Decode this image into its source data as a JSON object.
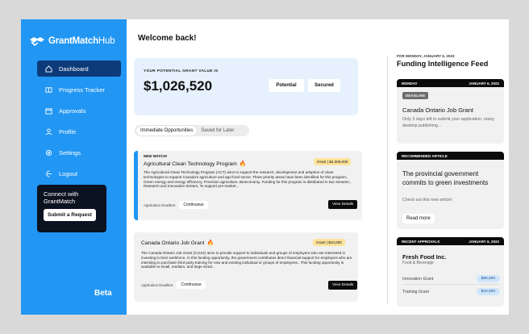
{
  "sidebar": {
    "brand": {
      "bold": "GrantMatch",
      "light": "Hub"
    },
    "items": [
      {
        "label": "Dashboard",
        "icon": "home-icon"
      },
      {
        "label": "Progress Tracker",
        "icon": "book-icon"
      },
      {
        "label": "Approvals",
        "icon": "calendar-icon"
      },
      {
        "label": "Profile",
        "icon": "user-icon"
      },
      {
        "label": "Settings",
        "icon": "gear-icon"
      },
      {
        "label": "Logout",
        "icon": "logout-icon"
      }
    ],
    "connect": {
      "title": "Connect with GrantMatch",
      "button": "Submit a Request"
    },
    "beta": "Beta"
  },
  "main": {
    "welcome": "Welcome back!",
    "value": {
      "label": "YOUR POTENTIAL GRANT VALUE IS",
      "amount": "$1,026,520",
      "potential": "Potential",
      "secured": "Secured"
    },
    "tabs": [
      "Immediate Opportunities",
      "Saved for Later"
    ],
    "grants": [
      {
        "new": "NEW MATCH!",
        "title": "Agricultural Clean Technology Program",
        "badge": "Grant | $2,000,000",
        "desc": "The Agricultural Clean Technology Program (ACT) aims to support the research, development and adoption of clean technologies to support Canada's agriculture and agri-food sector. Three priority areas have been identified for this program:, Green energy and energy efficiency, Precision agriculture, Bioeconomy. Funding for this program is distributed in two streams:, Research and Innovation Stream, To support pre-market...",
        "deadline_label": "Application Deadline:",
        "deadline": "Continuous",
        "button": "View Details"
      },
      {
        "title": "Canada Ontario Job Grant",
        "badge": "Grant | $10,000",
        "desc": "The Canada-Ontario Job Grant (COJG) aims to provide support to individuals and groups of employers who are interested in investing in their workforce. In this funding opportunity, the government contributes direct financial support for employers who are intending to purchase third party training for new and existing individual or groups of employees.. This funding opportunity is available to small, medium, and large sized...",
        "deadline_label": "Application Deadline:",
        "deadline": "Continuous",
        "button": "View Details"
      }
    ]
  },
  "feed": {
    "date": "FOR MONDAY, JANUARY 6, 2023",
    "title": "Funding Intelligence Feed",
    "card1": {
      "day": "MONDAY",
      "date": "JANUARY 6, 2022",
      "badge": "DEADLINE",
      "title": "Canada Ontario Job Grant",
      "sub": "Only 3 days left to submit your application, many desktop publishing..."
    },
    "card2": {
      "head": "RECOMMENDED ARTICLE",
      "title": "The provincial government commits to green investments",
      "sub": "Check out this new article!",
      "button": "Read more"
    },
    "card3": {
      "head": "RECENT APPROVALS",
      "date": "JANUARY 6, 2022",
      "company": "Fresh Food Inc.",
      "category": "Food & Beverage",
      "rows": [
        {
          "name": "Innovation Grant",
          "amount": "$80,000"
        },
        {
          "name": "Training Grant",
          "amount": "$10,000"
        }
      ]
    }
  },
  "colors": {
    "brand_blue": "#2196f3",
    "nav_active": "#0d3b7a",
    "badge_yellow": "#fde39a"
  }
}
